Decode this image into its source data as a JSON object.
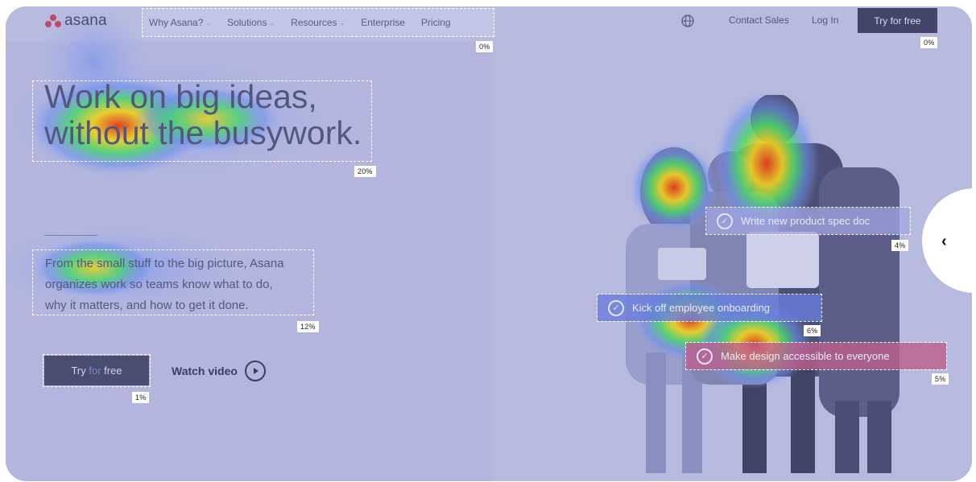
{
  "colors": {
    "overlay": "#b3b7df",
    "button_dark": "#414568",
    "heat_hot": "#e23a1c",
    "heat_warm": "#f1d21d",
    "heat_mid": "#49d86b",
    "heat_cool": "#6a8cf0"
  },
  "header": {
    "logo_text": "asana",
    "nav": [
      "Why Asana?",
      "Solutions",
      "Resources",
      "Enterprise",
      "Pricing"
    ],
    "nav_attention": "0%",
    "contact": "Contact Sales",
    "login": "Log In",
    "try_button": "Try for free",
    "try_attention": "0%",
    "globe_icon": "globe-icon"
  },
  "hero": {
    "title_line1": "Work on big ideas,",
    "title_line2": "without the busywork.",
    "title_attention": "20%",
    "subtitle_line1": "From the small stuff to the big picture, Asana",
    "subtitle_line2": "organizes work so teams know what to do,",
    "subtitle_line3": "why it matters, and how to get it done.",
    "subtitle_attention": "12%",
    "try_button_part1": "Try ",
    "try_button_part2": "for",
    "try_button_part3": " free",
    "try_attention": "1%",
    "watch_label": "Watch video"
  },
  "tasks": [
    {
      "label": "Write new product spec doc",
      "attention": "4%"
    },
    {
      "label": "Kick off employee onboarding",
      "attention": "6%"
    },
    {
      "label": "Make design accessible to everyone",
      "attention": "5%"
    }
  ],
  "carousel": {
    "prev_icon": "chevron-left-icon"
  }
}
